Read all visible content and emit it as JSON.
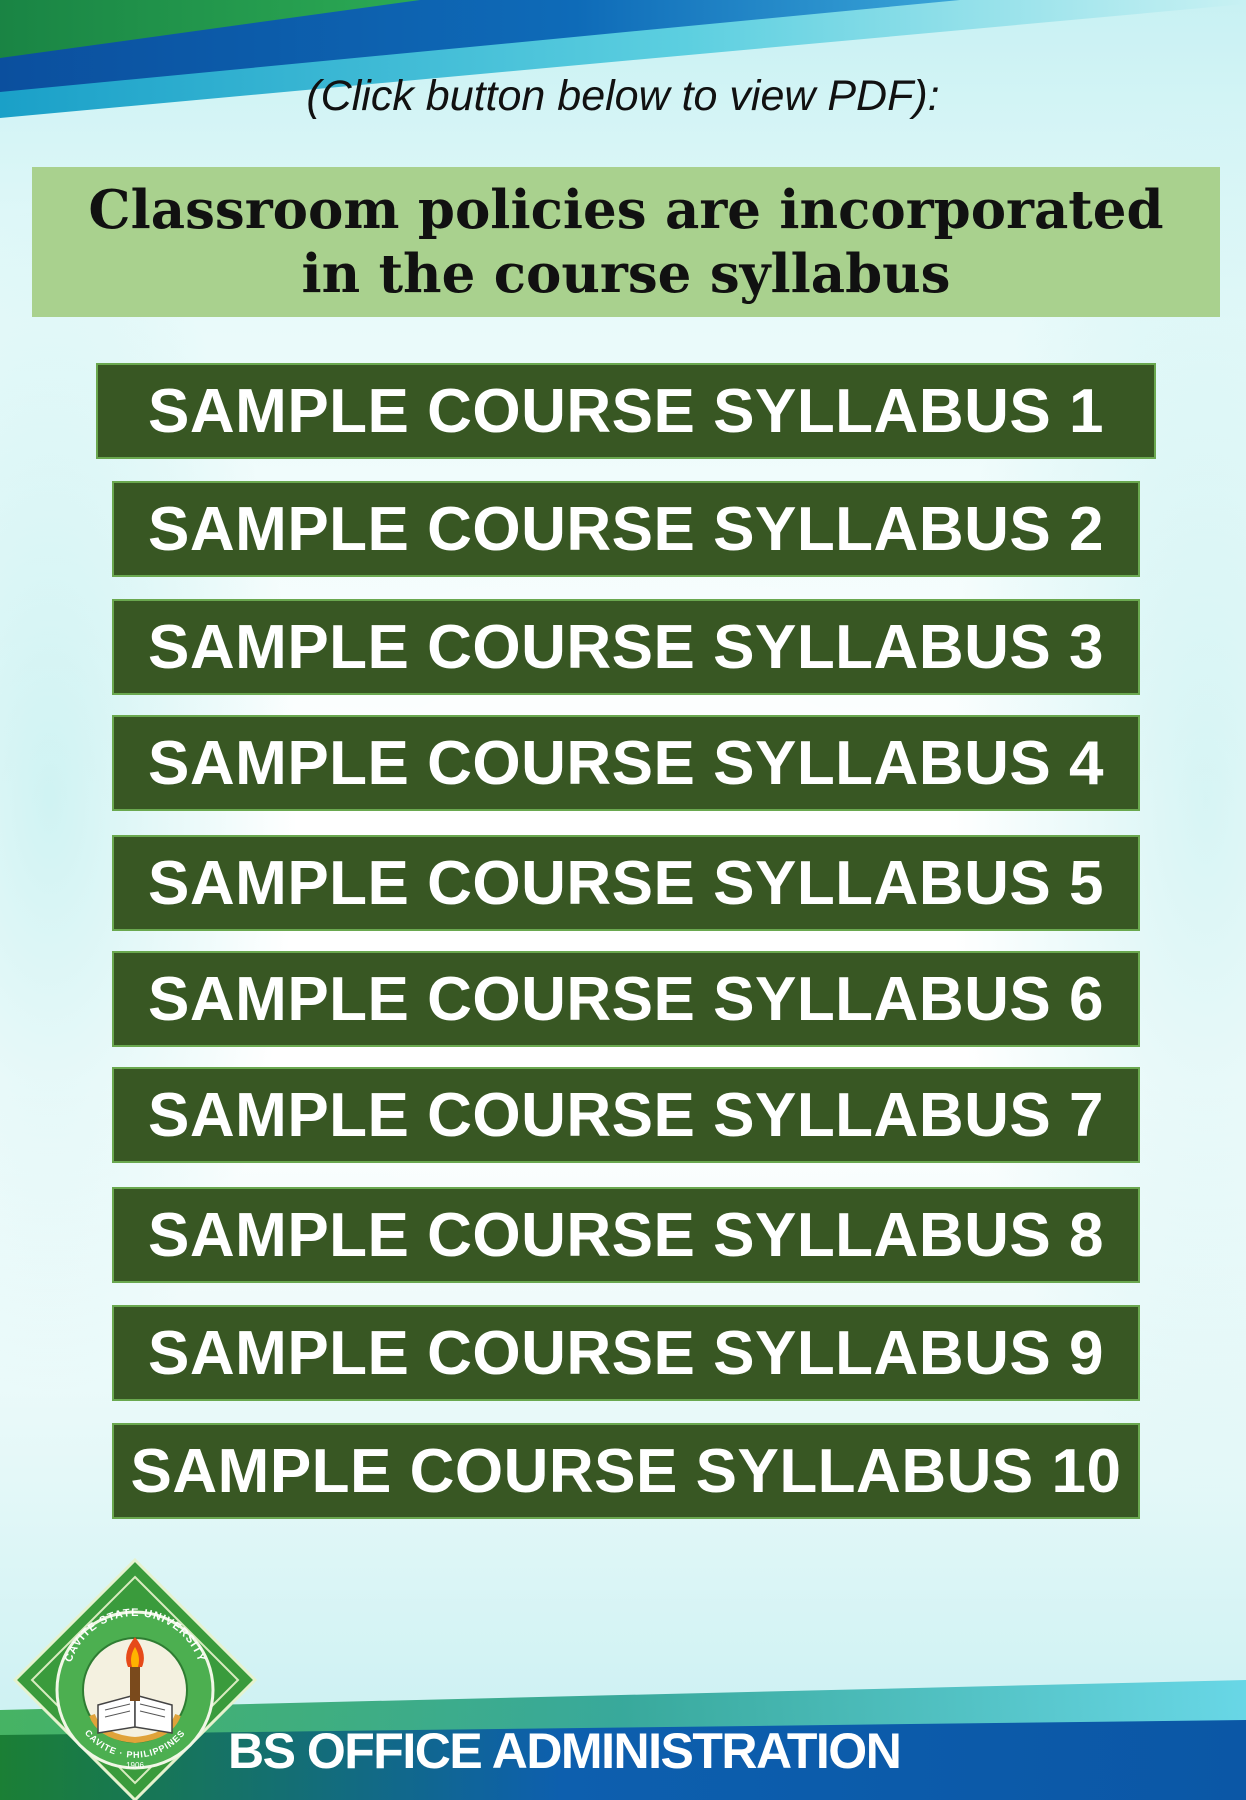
{
  "instruction": "(Click button below to view PDF):",
  "notice": {
    "line1": "Classroom policies are incorporated",
    "line2": "in the course syllabus"
  },
  "syllabus_buttons": [
    {
      "label": "SAMPLE COURSE SYLLABUS 1"
    },
    {
      "label": "SAMPLE COURSE SYLLABUS 2"
    },
    {
      "label": "SAMPLE COURSE SYLLABUS 3"
    },
    {
      "label": "SAMPLE COURSE SYLLABUS 4"
    },
    {
      "label": "SAMPLE COURSE SYLLABUS 5"
    },
    {
      "label": "SAMPLE COURSE SYLLABUS 6"
    },
    {
      "label": "SAMPLE COURSE SYLLABUS 7"
    },
    {
      "label": "SAMPLE COURSE SYLLABUS 8"
    },
    {
      "label": "SAMPLE COURSE SYLLABUS 9"
    },
    {
      "label": "SAMPLE COURSE SYLLABUS 10"
    }
  ],
  "footer": {
    "department": "BS OFFICE ADMINISTRATION",
    "logo": {
      "icon": "university-seal-icon",
      "text_top": "CAVITE STATE UNIVERSITY",
      "text_bottom": "CAVITE · PHILIPPINES",
      "year": "1906"
    }
  },
  "colors": {
    "button_bg": "#385723",
    "button_border": "#6aa84f",
    "notice_bg": "#a9d18e",
    "band_blue": "#0b5fb0",
    "band_green": "#1f9a3a"
  }
}
